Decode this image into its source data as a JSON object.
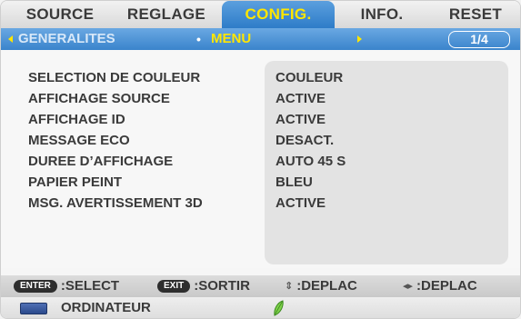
{
  "tabs": [
    {
      "label": "SOURCE",
      "active": false
    },
    {
      "label": "REGLAGE",
      "active": false
    },
    {
      "label": "CONFIG.",
      "active": true
    },
    {
      "label": "INFO.",
      "active": false
    },
    {
      "label": "RESET",
      "active": false
    }
  ],
  "subnav": {
    "left_label": "GENERALITES",
    "current_label": "MENU",
    "bullet": "•",
    "page": "1/4"
  },
  "settings": [
    {
      "label": "SELECTION DE COULEUR",
      "value": "COULEUR"
    },
    {
      "label": "AFFICHAGE SOURCE",
      "value": "ACTIVE"
    },
    {
      "label": "AFFICHAGE ID",
      "value": "ACTIVE"
    },
    {
      "label": "MESSAGE ECO",
      "value": "DESACT."
    },
    {
      "label": "DUREE D’AFFICHAGE",
      "value": "AUTO 45 S"
    },
    {
      "label": "PAPIER PEINT",
      "value": "BLEU"
    },
    {
      "label": "MSG. AVERTISSEMENT 3D",
      "value": "ACTIVE"
    }
  ],
  "hints": {
    "enter_key": "ENTER",
    "enter_text": ":SELECT",
    "exit_key": "EXIT",
    "exit_text": ":SORTIR",
    "updown_text": ":DEPLAC",
    "leftright_text": ":DEPLAC"
  },
  "status": {
    "source": "ORDINATEUR",
    "source_icon": "monitor-icon",
    "eco_icon": "leaf-icon"
  },
  "colors": {
    "accent_blue": "#2e7cc8",
    "active_text": "#ffe600",
    "eco_green": "#5cb82e"
  }
}
